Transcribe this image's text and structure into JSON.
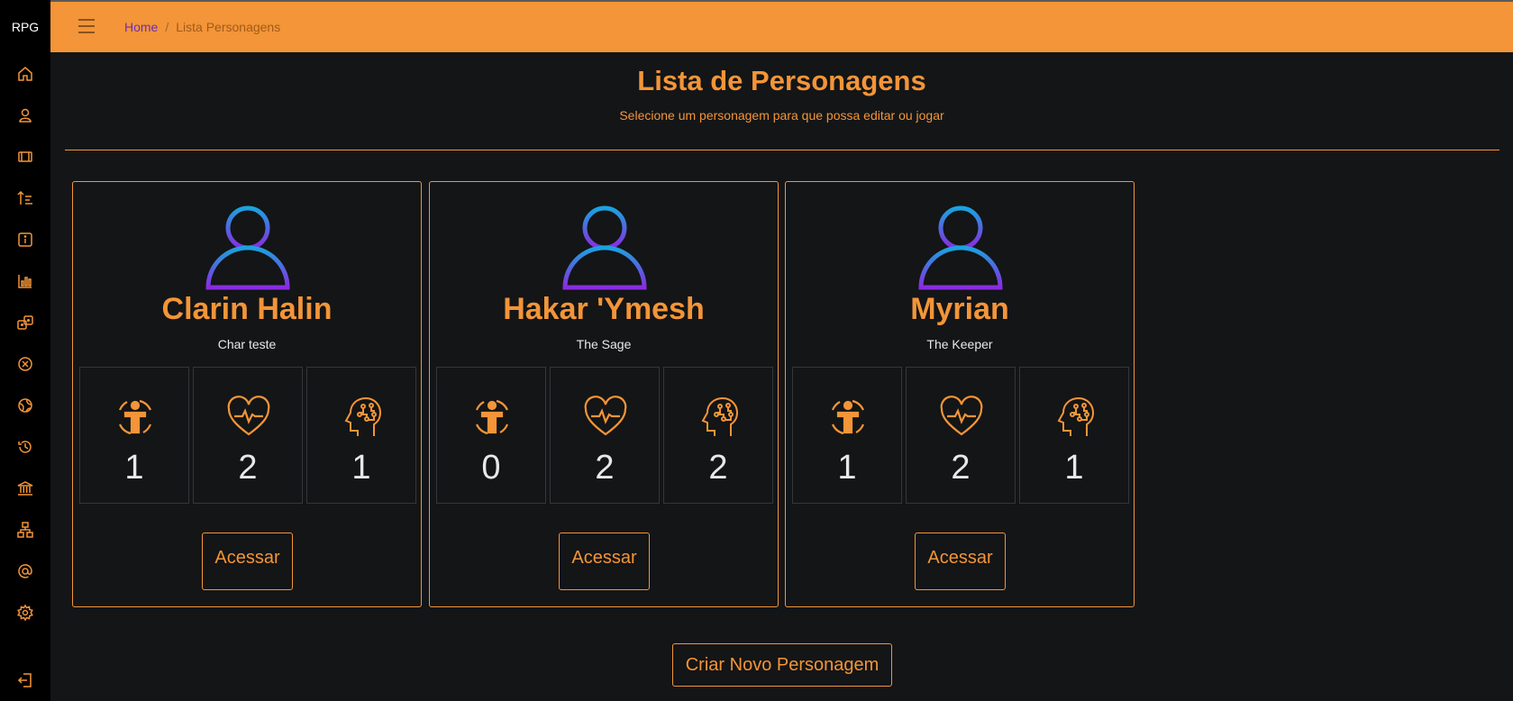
{
  "app": {
    "brand": "RPG"
  },
  "sidebar": {
    "items": [
      {
        "icon": "home-icon"
      },
      {
        "icon": "user-icon"
      },
      {
        "icon": "film-icon"
      },
      {
        "icon": "sort-icon"
      },
      {
        "icon": "info-icon"
      },
      {
        "icon": "bar-chart-icon"
      },
      {
        "icon": "dice-icon"
      },
      {
        "icon": "x-circle-icon"
      },
      {
        "icon": "globe-icon"
      },
      {
        "icon": "history-icon"
      },
      {
        "icon": "bank-icon"
      },
      {
        "icon": "diagram-icon"
      },
      {
        "icon": "at-icon"
      },
      {
        "icon": "gear-icon"
      },
      {
        "icon": "logout-icon"
      }
    ]
  },
  "header": {
    "breadcrumb": {
      "home": "Home",
      "separator": "/",
      "current": "Lista Personagens"
    }
  },
  "main": {
    "title": "Lista de Personagens",
    "subtitle": "Selecione um personagem para que possa editar ou jogar"
  },
  "characters": [
    {
      "name": "Clarin Halin",
      "class": "Char teste",
      "stats": [
        "1",
        "2",
        "1"
      ],
      "button": "Acessar"
    },
    {
      "name": "Hakar 'Ymesh",
      "class": "The Sage",
      "stats": [
        "0",
        "2",
        "2"
      ],
      "button": "Acessar"
    },
    {
      "name": "Myrian",
      "class": "The Keeper",
      "stats": [
        "1",
        "2",
        "1"
      ],
      "button": "Acessar"
    }
  ],
  "create_button": "Criar Novo Personagem",
  "colors": {
    "accent": "#f39538",
    "background": "#141516",
    "sidebar": "#000000",
    "avatar_top": "#1aa3e0",
    "avatar_bottom": "#8a2be2"
  }
}
